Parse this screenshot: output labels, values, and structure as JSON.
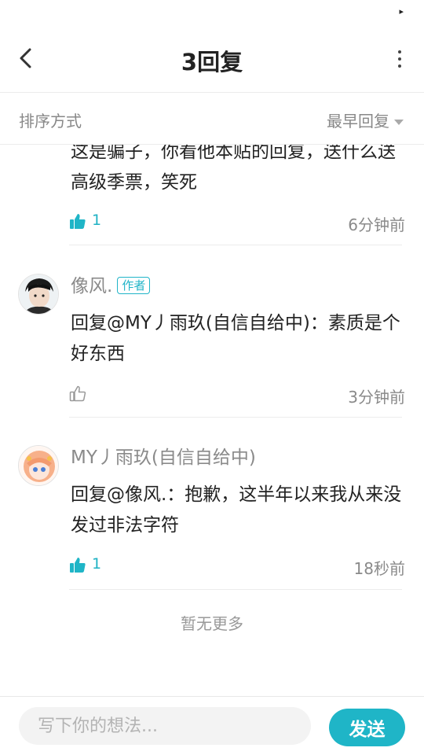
{
  "status_bar": {
    "glyph": "▸"
  },
  "header": {
    "title": "3回复",
    "back_icon": "chevron-left-icon",
    "more_icon": "more-vertical-icon"
  },
  "sort": {
    "label": "排序方式",
    "value": "最早回复"
  },
  "comments": [
    {
      "text": "这是骗子，你看他本贴的回复，送什么送高级季票，笑死",
      "likes": "1",
      "liked": true,
      "time": "6分钟前"
    },
    {
      "username": "像风.",
      "author_tag": "作者",
      "text": "回复@MY丿雨玖(自信自给中)：素质是个好东西",
      "likes": "",
      "liked": false,
      "time": "3分钟前"
    },
    {
      "username": "MY丿雨玖(自信自给中)",
      "text": "回复@像风.：抱歉，这半年以来我从来没发过非法字符",
      "likes": "1",
      "liked": true,
      "time": "18秒前"
    }
  ],
  "footer": {
    "no_more": "暂无更多"
  },
  "compose": {
    "placeholder": "写下你的想法...",
    "send_label": "发送"
  },
  "colors": {
    "accent": "#1fb5c7",
    "muted_text": "#8a8a8a",
    "divider": "#ececec"
  }
}
